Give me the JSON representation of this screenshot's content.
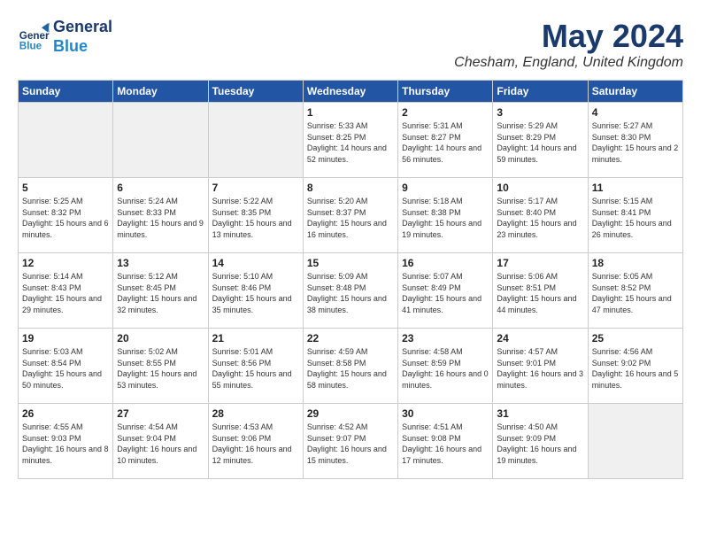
{
  "header": {
    "logo_line1": "General",
    "logo_line2": "Blue",
    "month": "May 2024",
    "location": "Chesham, England, United Kingdom"
  },
  "days_of_week": [
    "Sunday",
    "Monday",
    "Tuesday",
    "Wednesday",
    "Thursday",
    "Friday",
    "Saturday"
  ],
  "weeks": [
    [
      {
        "day": null,
        "info": null
      },
      {
        "day": null,
        "info": null
      },
      {
        "day": null,
        "info": null
      },
      {
        "day": "1",
        "info": "Sunrise: 5:33 AM\nSunset: 8:25 PM\nDaylight: 14 hours\nand 52 minutes."
      },
      {
        "day": "2",
        "info": "Sunrise: 5:31 AM\nSunset: 8:27 PM\nDaylight: 14 hours\nand 56 minutes."
      },
      {
        "day": "3",
        "info": "Sunrise: 5:29 AM\nSunset: 8:29 PM\nDaylight: 14 hours\nand 59 minutes."
      },
      {
        "day": "4",
        "info": "Sunrise: 5:27 AM\nSunset: 8:30 PM\nDaylight: 15 hours\nand 2 minutes."
      }
    ],
    [
      {
        "day": "5",
        "info": "Sunrise: 5:25 AM\nSunset: 8:32 PM\nDaylight: 15 hours\nand 6 minutes."
      },
      {
        "day": "6",
        "info": "Sunrise: 5:24 AM\nSunset: 8:33 PM\nDaylight: 15 hours\nand 9 minutes."
      },
      {
        "day": "7",
        "info": "Sunrise: 5:22 AM\nSunset: 8:35 PM\nDaylight: 15 hours\nand 13 minutes."
      },
      {
        "day": "8",
        "info": "Sunrise: 5:20 AM\nSunset: 8:37 PM\nDaylight: 15 hours\nand 16 minutes."
      },
      {
        "day": "9",
        "info": "Sunrise: 5:18 AM\nSunset: 8:38 PM\nDaylight: 15 hours\nand 19 minutes."
      },
      {
        "day": "10",
        "info": "Sunrise: 5:17 AM\nSunset: 8:40 PM\nDaylight: 15 hours\nand 23 minutes."
      },
      {
        "day": "11",
        "info": "Sunrise: 5:15 AM\nSunset: 8:41 PM\nDaylight: 15 hours\nand 26 minutes."
      }
    ],
    [
      {
        "day": "12",
        "info": "Sunrise: 5:14 AM\nSunset: 8:43 PM\nDaylight: 15 hours\nand 29 minutes."
      },
      {
        "day": "13",
        "info": "Sunrise: 5:12 AM\nSunset: 8:45 PM\nDaylight: 15 hours\nand 32 minutes."
      },
      {
        "day": "14",
        "info": "Sunrise: 5:10 AM\nSunset: 8:46 PM\nDaylight: 15 hours\nand 35 minutes."
      },
      {
        "day": "15",
        "info": "Sunrise: 5:09 AM\nSunset: 8:48 PM\nDaylight: 15 hours\nand 38 minutes."
      },
      {
        "day": "16",
        "info": "Sunrise: 5:07 AM\nSunset: 8:49 PM\nDaylight: 15 hours\nand 41 minutes."
      },
      {
        "day": "17",
        "info": "Sunrise: 5:06 AM\nSunset: 8:51 PM\nDaylight: 15 hours\nand 44 minutes."
      },
      {
        "day": "18",
        "info": "Sunrise: 5:05 AM\nSunset: 8:52 PM\nDaylight: 15 hours\nand 47 minutes."
      }
    ],
    [
      {
        "day": "19",
        "info": "Sunrise: 5:03 AM\nSunset: 8:54 PM\nDaylight: 15 hours\nand 50 minutes."
      },
      {
        "day": "20",
        "info": "Sunrise: 5:02 AM\nSunset: 8:55 PM\nDaylight: 15 hours\nand 53 minutes."
      },
      {
        "day": "21",
        "info": "Sunrise: 5:01 AM\nSunset: 8:56 PM\nDaylight: 15 hours\nand 55 minutes."
      },
      {
        "day": "22",
        "info": "Sunrise: 4:59 AM\nSunset: 8:58 PM\nDaylight: 15 hours\nand 58 minutes."
      },
      {
        "day": "23",
        "info": "Sunrise: 4:58 AM\nSunset: 8:59 PM\nDaylight: 16 hours\nand 0 minutes."
      },
      {
        "day": "24",
        "info": "Sunrise: 4:57 AM\nSunset: 9:01 PM\nDaylight: 16 hours\nand 3 minutes."
      },
      {
        "day": "25",
        "info": "Sunrise: 4:56 AM\nSunset: 9:02 PM\nDaylight: 16 hours\nand 5 minutes."
      }
    ],
    [
      {
        "day": "26",
        "info": "Sunrise: 4:55 AM\nSunset: 9:03 PM\nDaylight: 16 hours\nand 8 minutes."
      },
      {
        "day": "27",
        "info": "Sunrise: 4:54 AM\nSunset: 9:04 PM\nDaylight: 16 hours\nand 10 minutes."
      },
      {
        "day": "28",
        "info": "Sunrise: 4:53 AM\nSunset: 9:06 PM\nDaylight: 16 hours\nand 12 minutes."
      },
      {
        "day": "29",
        "info": "Sunrise: 4:52 AM\nSunset: 9:07 PM\nDaylight: 16 hours\nand 15 minutes."
      },
      {
        "day": "30",
        "info": "Sunrise: 4:51 AM\nSunset: 9:08 PM\nDaylight: 16 hours\nand 17 minutes."
      },
      {
        "day": "31",
        "info": "Sunrise: 4:50 AM\nSunset: 9:09 PM\nDaylight: 16 hours\nand 19 minutes."
      },
      {
        "day": null,
        "info": null
      }
    ]
  ]
}
